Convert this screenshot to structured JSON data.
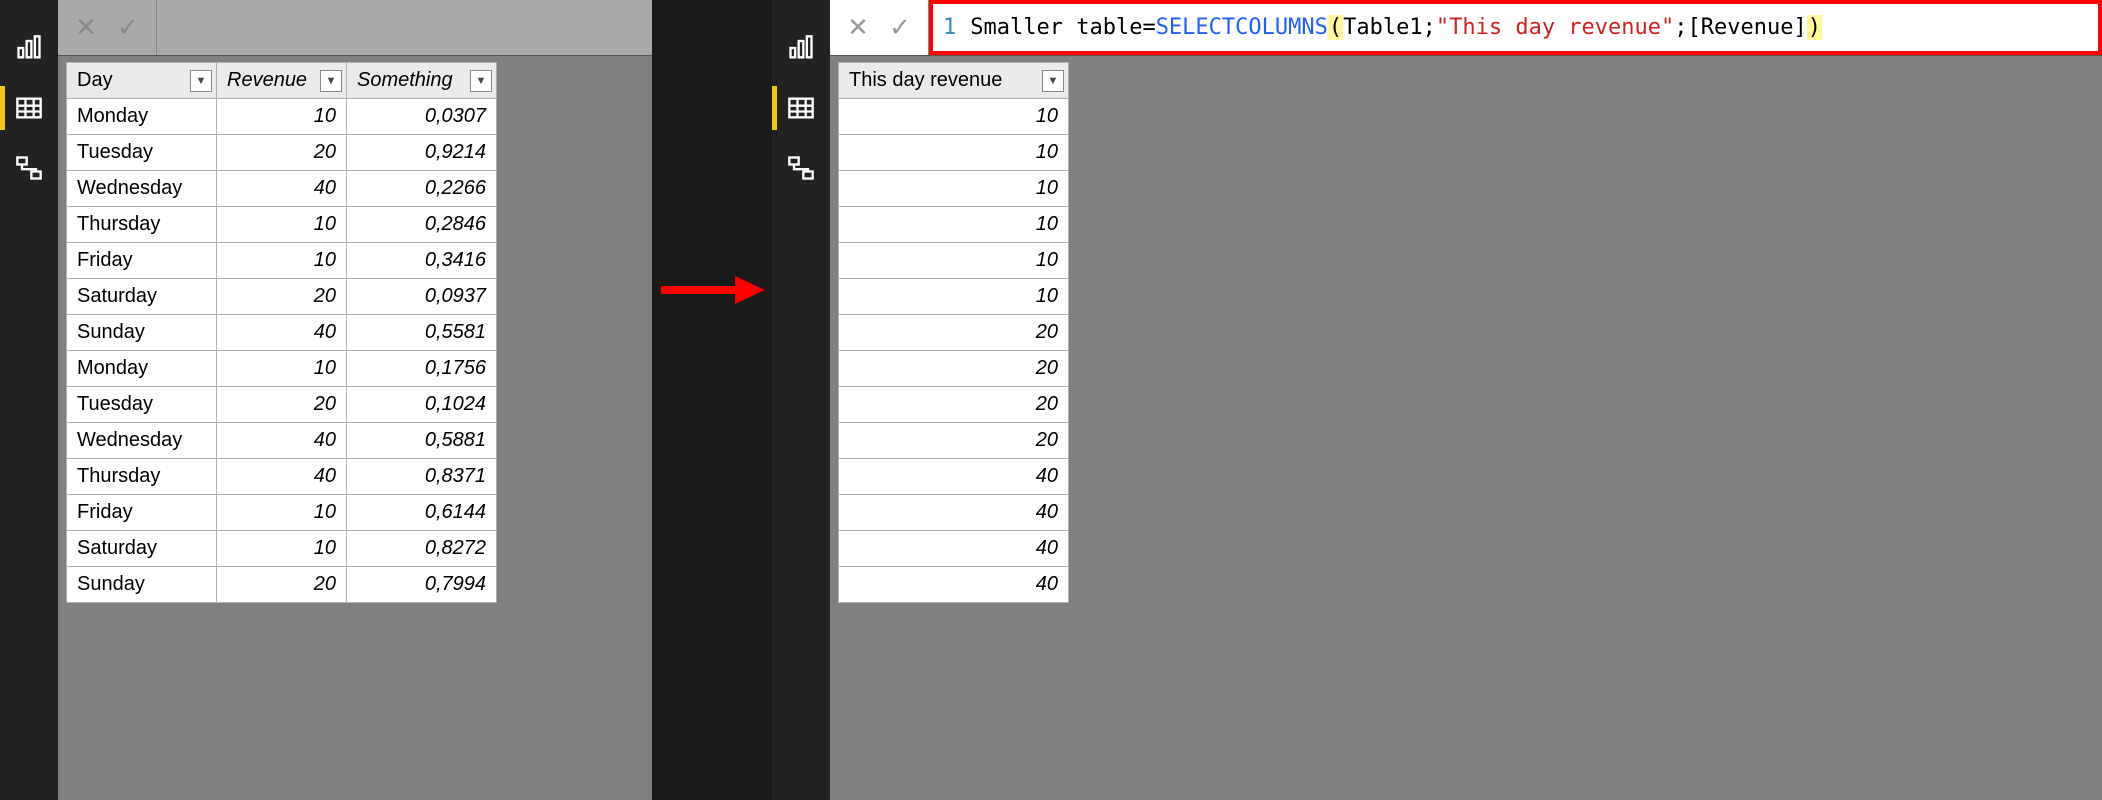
{
  "left": {
    "columns": {
      "day": "Day",
      "revenue": "Revenue",
      "something": "Something"
    },
    "rows": [
      {
        "day": "Monday",
        "rev": "10",
        "som": "0,0307"
      },
      {
        "day": "Tuesday",
        "rev": "20",
        "som": "0,9214"
      },
      {
        "day": "Wednesday",
        "rev": "40",
        "som": "0,2266"
      },
      {
        "day": "Thursday",
        "rev": "10",
        "som": "0,2846"
      },
      {
        "day": "Friday",
        "rev": "10",
        "som": "0,3416"
      },
      {
        "day": "Saturday",
        "rev": "20",
        "som": "0,0937"
      },
      {
        "day": "Sunday",
        "rev": "40",
        "som": "0,5581"
      },
      {
        "day": "Monday",
        "rev": "10",
        "som": "0,1756"
      },
      {
        "day": "Tuesday",
        "rev": "20",
        "som": "0,1024"
      },
      {
        "day": "Wednesday",
        "rev": "40",
        "som": "0,5881"
      },
      {
        "day": "Thursday",
        "rev": "40",
        "som": "0,8371"
      },
      {
        "day": "Friday",
        "rev": "10",
        "som": "0,6144"
      },
      {
        "day": "Saturday",
        "rev": "10",
        "som": "0,8272"
      },
      {
        "day": "Sunday",
        "rev": "20",
        "som": "0,7994"
      }
    ]
  },
  "right": {
    "formula": {
      "line_no": "1",
      "name": "Smaller table",
      "eq": " = ",
      "func": "SELECTCOLUMNS",
      "open": "(",
      "arg1": "Table1",
      "sep1": ";",
      "arg2": "\"This day revenue\"",
      "sep2": ";",
      "arg3": "[Revenue]",
      "close": ")"
    },
    "column": "This day revenue",
    "rows": [
      "10",
      "10",
      "10",
      "10",
      "10",
      "10",
      "20",
      "20",
      "20",
      "20",
      "40",
      "40",
      "40",
      "40"
    ]
  },
  "icons": {
    "cancel_glyph": "✕",
    "commit_glyph": "✓",
    "dropdown_glyph": "▼"
  }
}
